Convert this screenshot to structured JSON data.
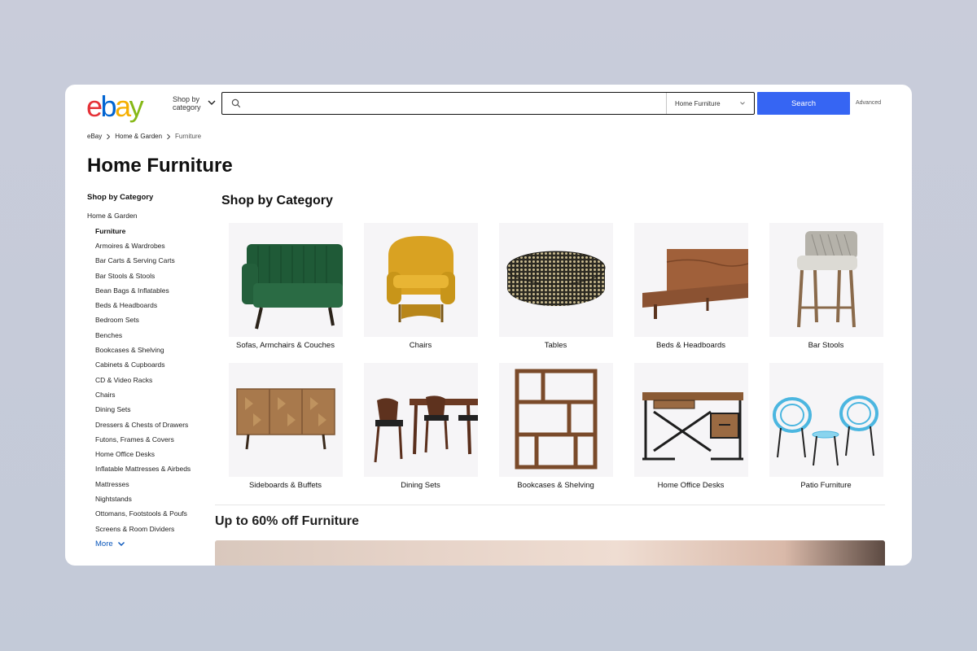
{
  "header": {
    "logo": [
      "e",
      "b",
      "a",
      "y"
    ],
    "shop_by": "Shop by category",
    "search_placeholder": "",
    "category_select": "Home Furniture",
    "search_button": "Search",
    "advanced": "Advanced"
  },
  "breadcrumb": [
    "eBay",
    "Home & Garden",
    "Furniture"
  ],
  "page_title": "Home Furniture",
  "sidebar": {
    "heading": "Shop by Category",
    "parent": "Home & Garden",
    "current": "Furniture",
    "items": [
      "Armoires & Wardrobes",
      "Bar Carts & Serving Carts",
      "Bar Stools & Stools",
      "Bean Bags & Inflatables",
      "Beds & Headboards",
      "Bedroom Sets",
      "Benches",
      "Bookcases & Shelving",
      "Cabinets & Cupboards",
      "CD & Video Racks",
      "Chairs",
      "Dining Sets",
      "Dressers & Chests of Drawers",
      "Futons, Frames & Covers",
      "Home Office Desks",
      "Inflatable Mattresses & Airbeds",
      "Mattresses",
      "Nightstands",
      "Ottomans, Footstools & Poufs",
      "Screens & Room Dividers"
    ],
    "more": "More"
  },
  "main": {
    "section_title": "Shop by Category",
    "categories": [
      {
        "label": "Sofas, Armchairs & Couches",
        "icon": "sofa-image"
      },
      {
        "label": "Chairs",
        "icon": "chair-image"
      },
      {
        "label": "Tables",
        "icon": "table-image"
      },
      {
        "label": "Beds & Headboards",
        "icon": "bed-image"
      },
      {
        "label": "Bar Stools",
        "icon": "bar-stool-image"
      },
      {
        "label": "Sideboards & Buffets",
        "icon": "sideboard-image"
      },
      {
        "label": "Dining Sets",
        "icon": "dining-set-image"
      },
      {
        "label": "Bookcases & Shelving",
        "icon": "bookcase-image"
      },
      {
        "label": "Home Office Desks",
        "icon": "desk-image"
      },
      {
        "label": "Patio Furniture",
        "icon": "patio-image"
      }
    ],
    "promo_title": "Up to 60% off Furniture"
  },
  "colors": {
    "search_button": "#3665f3",
    "link": "#0654ba",
    "logo_e": "#e53238",
    "logo_b": "#0064d2",
    "logo_a": "#f5af02",
    "logo_y": "#86b817"
  }
}
